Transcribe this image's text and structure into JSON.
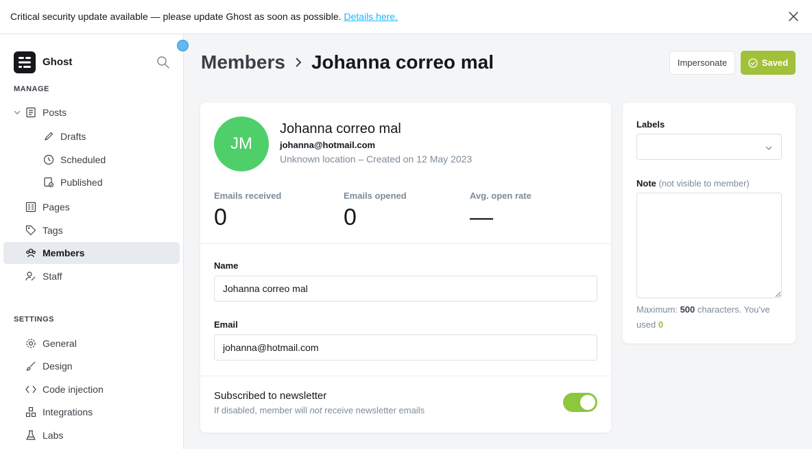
{
  "banner": {
    "text": "Critical security update available — please update Ghost as soon as possible.",
    "link": "Details here."
  },
  "sidebar": {
    "brand": "Ghost",
    "manage_heading": "MANAGE",
    "settings_heading": "SETTINGS",
    "manage_items": [
      {
        "label": "Posts",
        "icon": "posts-icon"
      },
      {
        "label": "Drafts",
        "icon": "pencil-icon"
      },
      {
        "label": "Scheduled",
        "icon": "clock-icon"
      },
      {
        "label": "Published",
        "icon": "published-icon"
      },
      {
        "label": "Pages",
        "icon": "pages-icon"
      },
      {
        "label": "Tags",
        "icon": "tag-icon"
      },
      {
        "label": "Members",
        "icon": "members-icon",
        "active": true
      },
      {
        "label": "Staff",
        "icon": "staff-icon"
      }
    ],
    "settings_items": [
      {
        "label": "General",
        "icon": "gear-icon"
      },
      {
        "label": "Design",
        "icon": "brush-icon"
      },
      {
        "label": "Code injection",
        "icon": "code-icon"
      },
      {
        "label": "Integrations",
        "icon": "integrations-icon"
      },
      {
        "label": "Labs",
        "icon": "flask-icon"
      }
    ]
  },
  "header": {
    "breadcrumb_parent": "Members",
    "breadcrumb_current": "Johanna correo mal",
    "impersonate_label": "Impersonate",
    "saved_label": "Saved"
  },
  "member": {
    "initials": "JM",
    "name": "Johanna correo mal",
    "email": "johanna@hotmail.com",
    "meta": "Unknown location – Created on 12 May 2023",
    "stats": [
      {
        "label": "Emails received",
        "value": "0"
      },
      {
        "label": "Emails opened",
        "value": "0"
      },
      {
        "label": "Avg. open rate",
        "value": "—"
      }
    ]
  },
  "form": {
    "name_label": "Name",
    "name_value": "Johanna correo mal",
    "email_label": "Email",
    "email_value": "johanna@hotmail.com",
    "newsletter_title": "Subscribed to newsletter",
    "newsletter_sub_a": "If disabled, member will ",
    "newsletter_sub_em": "not",
    "newsletter_sub_b": " receive newsletter emails",
    "newsletter_enabled": true
  },
  "side": {
    "labels_title": "Labels",
    "note_title": "Note",
    "note_hint": "(not visible to member)",
    "help_a": "Maximum: ",
    "help_max": "500",
    "help_b": " characters. You've used ",
    "help_used": "0"
  },
  "colors": {
    "accent_green": "#a2c13a",
    "toggle_green": "#8dc63f",
    "avatar_green": "#4fcf6a",
    "link_blue": "#14b8ff"
  }
}
